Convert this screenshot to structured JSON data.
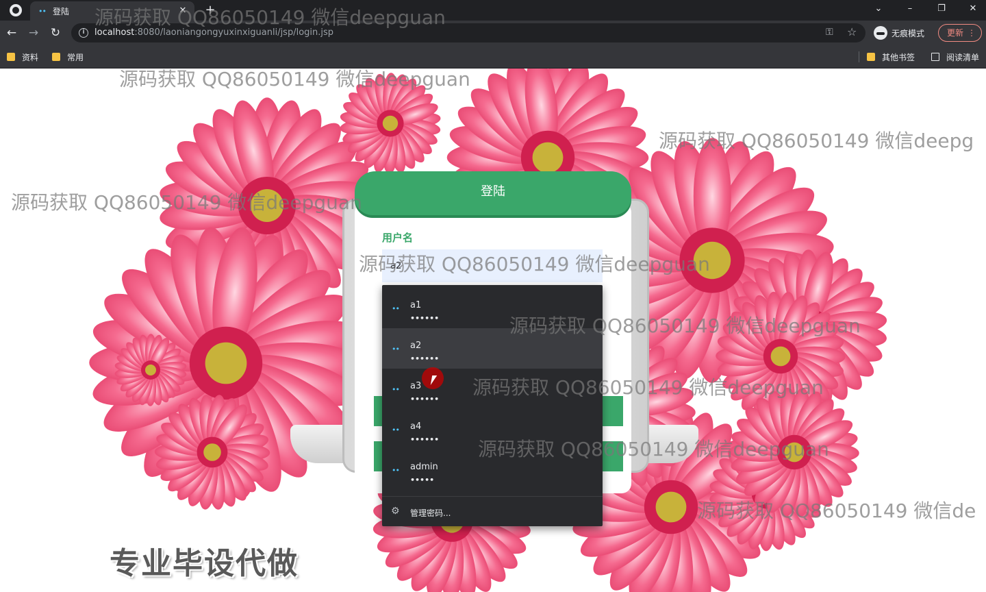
{
  "browser": {
    "tab_title": "登陆",
    "tab_favicon": "••",
    "tab_close": "✕",
    "new_tab": "+",
    "win_controls": {
      "chevron": "⌄",
      "minimize": "–",
      "restore": "❐",
      "close": "✕"
    },
    "url_host": "localhost",
    "url_rest": ":8080/laoniangongyuxinxiguanli/jsp/login.jsp",
    "incognito_label": "无痕模式",
    "update_label": "更新",
    "update_menu": "⋮",
    "bookmarks": [
      "资料",
      "常用"
    ],
    "other_bookmarks": "其他书签",
    "reading_list": "阅读清单"
  },
  "login": {
    "title": "登陆",
    "username_label": "用户名",
    "username_value": "a2"
  },
  "autofill": {
    "items": [
      {
        "user": "a1",
        "mask": "••••••"
      },
      {
        "user": "a2",
        "mask": "••••••"
      },
      {
        "user": "a3",
        "mask": "••••••"
      },
      {
        "user": "a4",
        "mask": "••••••"
      },
      {
        "user": "admin",
        "mask": "•••••"
      }
    ],
    "key_glyph": "••",
    "manage_label": "管理密码..."
  },
  "promo_text": "专业毕设代做",
  "watermarks": [
    "源码获取 QQ86050149 微信deepguan",
    "源码获取 QQ86050149 微信deepguan",
    "源码获取 QQ86050149 微信deepg",
    "源码获取 QQ86050149 微信deepguan",
    "源码获取 QQ86050149 微信deepguan",
    "源码获取 QQ86050149 微信deepguan",
    "源码获取 QQ86050149 微信deepguan",
    "源码获取 QQ86050149 微信deepguan",
    "源码获取 QQ86050149 微信de"
  ],
  "colors": {
    "accent_green": "#3aa76a",
    "flower_pink": "#f0507a",
    "flower_center": "#c8b23a"
  }
}
